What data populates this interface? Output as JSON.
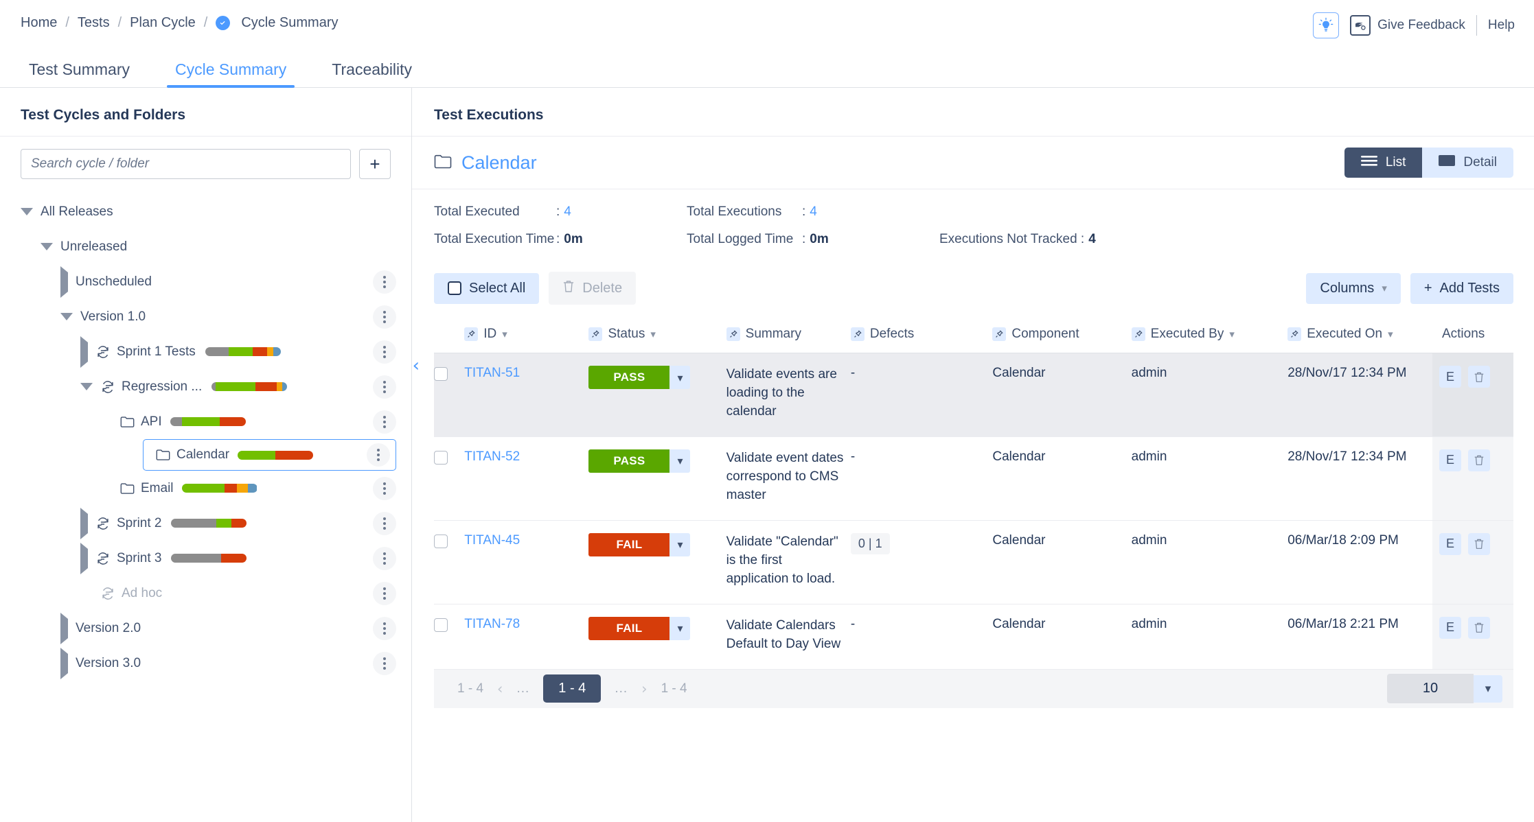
{
  "breadcrumb": {
    "items": [
      "Home",
      "Tests",
      "Plan Cycle",
      "Cycle Summary"
    ],
    "separator": "/"
  },
  "topbar": {
    "feedback_label": "Give Feedback",
    "help_label": "Help"
  },
  "tabs": [
    {
      "label": "Test Summary",
      "active": false
    },
    {
      "label": "Cycle Summary",
      "active": true
    },
    {
      "label": "Traceability",
      "active": false
    }
  ],
  "sidebar": {
    "title": "Test Cycles and Folders",
    "search_placeholder": "Search cycle / folder",
    "search_value": "",
    "add_label": "+",
    "tree": [
      {
        "label": "All Releases",
        "type": "root",
        "caret": "down",
        "indent": 0,
        "kebab": false,
        "bar": null
      },
      {
        "label": "Unreleased",
        "type": "group",
        "caret": "down",
        "indent": 1,
        "kebab": false,
        "bar": null
      },
      {
        "label": "Unscheduled",
        "type": "group",
        "caret": "right",
        "indent": 2,
        "kebab": true,
        "bar": null
      },
      {
        "label": "Version 1.0",
        "type": "group",
        "caret": "down",
        "indent": 2,
        "kebab": true,
        "bar": null
      },
      {
        "label": "Sprint 1 Tests",
        "type": "cycle",
        "caret": "right",
        "indent": 3,
        "kebab": true,
        "bar": [
          {
            "color": "#8c8c8c",
            "pct": 31
          },
          {
            "color": "#72bf00",
            "pct": 32
          },
          {
            "color": "#d63d0a",
            "pct": 19
          },
          {
            "color": "#f6a609",
            "pct": 8
          },
          {
            "color": "#5f95bd",
            "pct": 10
          }
        ]
      },
      {
        "label": "Regression ...",
        "type": "cycle",
        "caret": "down",
        "indent": 3,
        "kebab": true,
        "bar": [
          {
            "color": "#8c8c8c",
            "pct": 5
          },
          {
            "color": "#72bf00",
            "pct": 53
          },
          {
            "color": "#d63d0a",
            "pct": 28
          },
          {
            "color": "#f6a609",
            "pct": 7
          },
          {
            "color": "#5f95bd",
            "pct": 7
          }
        ]
      },
      {
        "label": "API",
        "type": "folder",
        "caret": "none",
        "indent": 4,
        "kebab": true,
        "bar": [
          {
            "color": "#8c8c8c",
            "pct": 16
          },
          {
            "color": "#72bf00",
            "pct": 50
          },
          {
            "color": "#d63d0a",
            "pct": 34
          }
        ]
      },
      {
        "label": "Calendar",
        "type": "folder",
        "caret": "none",
        "indent": 4,
        "kebab": true,
        "selected": true,
        "bar": [
          {
            "color": "#72bf00",
            "pct": 50
          },
          {
            "color": "#d63d0a",
            "pct": 50
          }
        ]
      },
      {
        "label": "Email",
        "type": "folder",
        "caret": "none",
        "indent": 4,
        "kebab": true,
        "bar": [
          {
            "color": "#72bf00",
            "pct": 57
          },
          {
            "color": "#d63d0a",
            "pct": 16
          },
          {
            "color": "#f6a609",
            "pct": 15
          },
          {
            "color": "#5f95bd",
            "pct": 12
          }
        ]
      },
      {
        "label": "Sprint 2",
        "type": "cycle",
        "caret": "right",
        "indent": 3,
        "kebab": true,
        "bar": [
          {
            "color": "#8c8c8c",
            "pct": 60
          },
          {
            "color": "#72bf00",
            "pct": 20
          },
          {
            "color": "#d63d0a",
            "pct": 20
          }
        ]
      },
      {
        "label": "Sprint 3",
        "type": "cycle",
        "caret": "right",
        "indent": 3,
        "kebab": true,
        "bar": [
          {
            "color": "#8c8c8c",
            "pct": 66
          },
          {
            "color": "#d63d0a",
            "pct": 34
          }
        ]
      },
      {
        "label": "Ad hoc",
        "type": "cycle",
        "caret": "none",
        "indent": 3,
        "kebab": true,
        "muted": true,
        "bar": null
      },
      {
        "label": "Version 2.0",
        "type": "group",
        "caret": "right",
        "indent": 2,
        "kebab": true,
        "bar": null
      },
      {
        "label": "Version 3.0",
        "type": "group",
        "caret": "right",
        "indent": 2,
        "kebab": true,
        "bar": null
      }
    ]
  },
  "executions": {
    "title": "Test Executions",
    "folder_name": "Calendar",
    "view_modes": [
      {
        "label": "List",
        "active": true
      },
      {
        "label": "Detail",
        "active": false
      }
    ],
    "stats": {
      "total_executed_label": "Total Executed",
      "total_executed_value": "4",
      "total_executions_label": "Total Executions",
      "total_executions_value": "4",
      "total_execution_time_label": "Total Execution Time",
      "total_execution_time_value": "0m",
      "total_logged_time_label": "Total Logged Time",
      "total_logged_time_value": "0m",
      "not_tracked_label": "Executions Not Tracked :",
      "not_tracked_value": "4"
    },
    "toolbar": {
      "select_all_label": "Select All",
      "delete_label": "Delete",
      "columns_label": "Columns",
      "add_tests_label": "Add Tests"
    },
    "columns": [
      {
        "label": "ID",
        "pin": true,
        "sort": true
      },
      {
        "label": "Status",
        "pin": true,
        "sort": true
      },
      {
        "label": "Summary",
        "pin": true,
        "sort": false
      },
      {
        "label": "Defects",
        "pin": true,
        "sort": false
      },
      {
        "label": "Component",
        "pin": true,
        "sort": false
      },
      {
        "label": "Executed By",
        "pin": true,
        "sort": true
      },
      {
        "label": "Executed On",
        "pin": true,
        "sort": true
      },
      {
        "label": "Actions",
        "pin": false,
        "sort": false
      }
    ],
    "rows": [
      {
        "id": "TITAN-51",
        "status": "PASS",
        "status_kind": "pass",
        "summary": "Validate events are loading to the calendar",
        "defects": "-",
        "defects_pill": false,
        "component": "Calendar",
        "executed_by": "admin",
        "executed_on": "28/Nov/17 12:34 PM",
        "highlight": true,
        "edit_label": "E"
      },
      {
        "id": "TITAN-52",
        "status": "PASS",
        "status_kind": "pass",
        "summary": "Validate event dates correspond to CMS master",
        "defects": "-",
        "defects_pill": false,
        "component": "Calendar",
        "executed_by": "admin",
        "executed_on": "28/Nov/17 12:34 PM",
        "highlight": false,
        "edit_label": "E"
      },
      {
        "id": "TITAN-45",
        "status": "FAIL",
        "status_kind": "fail",
        "summary": "Validate \"Calendar\" is the first application to load.",
        "defects": "0 | 1",
        "defects_pill": true,
        "component": "Calendar",
        "executed_by": "admin",
        "executed_on": "06/Mar/18 2:09 PM",
        "highlight": false,
        "edit_label": "E"
      },
      {
        "id": "TITAN-78",
        "status": "FAIL",
        "status_kind": "fail",
        "summary": "Validate Calendars Default to Day View",
        "defects": "-",
        "defects_pill": false,
        "component": "Calendar",
        "executed_by": "admin",
        "executed_on": "06/Mar/18 2:21 PM",
        "highlight": false,
        "edit_label": "E"
      }
    ],
    "pagination": {
      "start_range": "1 - 4",
      "prev_dots": "...",
      "active_page": "1 - 4",
      "next_dots": "...",
      "end_range": "1 - 4",
      "page_size": "10"
    }
  },
  "colors": {
    "accent_blue": "#4c9aff",
    "pass_green": "#5aa700",
    "fail_red": "#d63d0a",
    "navy": "#42526e",
    "light_blue_bg": "#deebff"
  }
}
